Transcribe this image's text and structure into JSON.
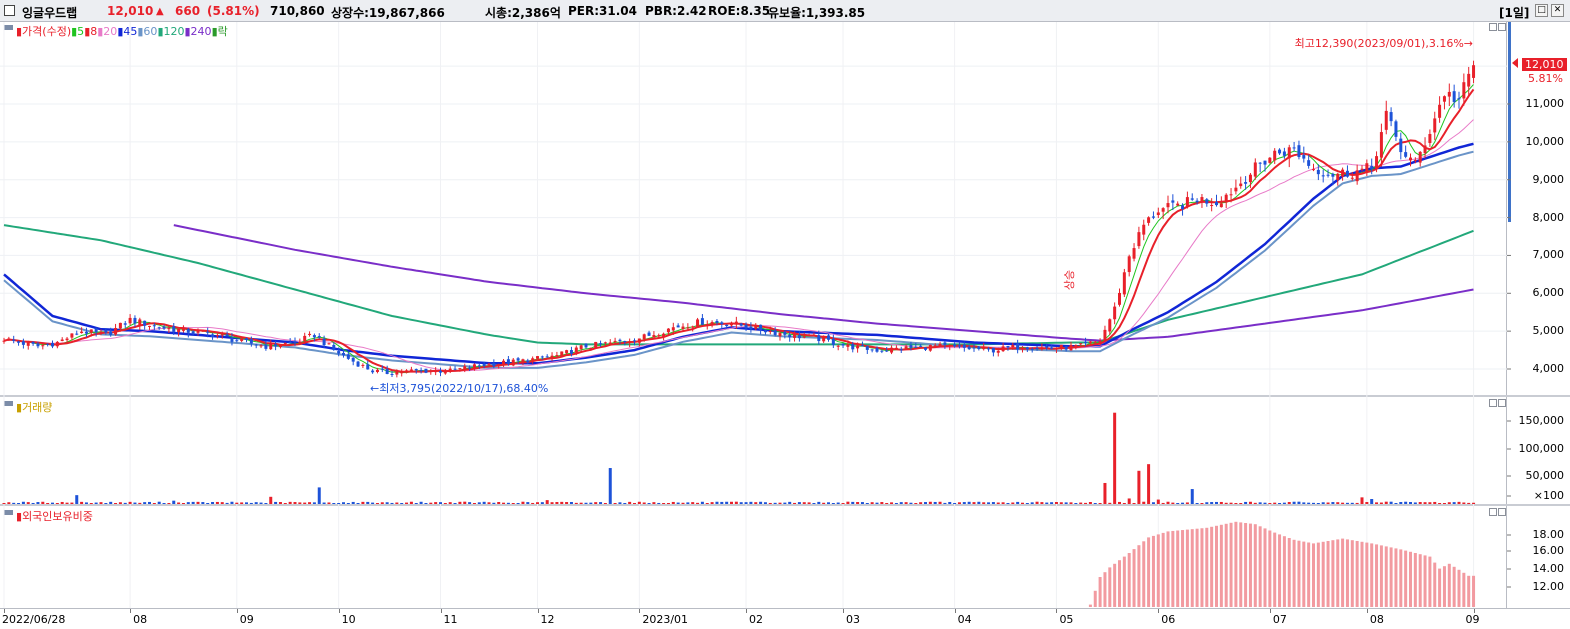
{
  "header": {
    "stock_name": "잉글우드랩",
    "price": "12,010",
    "change_arrow": "▲",
    "change": "660",
    "change_pct": "(5.81%)",
    "volume": "710,860",
    "listed_shares": "상장수:19,867,866",
    "market_cap": "시총:2,386억",
    "per": "PER:31.04",
    "pbr": "PBR:2.42",
    "roe": "ROE:8.35",
    "reserve_ratio": "유보율:1,393.85",
    "period": "[1일]",
    "minimize_label": "□",
    "close_label": "✕"
  },
  "colors": {
    "up": "#e8202a",
    "down": "#1d52d8",
    "ma5": "#1fc41f",
    "ma8": "#e8202a",
    "ma20": "#e87ac8",
    "ma45": "#1026d6",
    "ma60": "#6a94c8",
    "ma120": "#22a87a",
    "ma240": "#7a2ec8",
    "fall": "#2a9a2a",
    "volume_legend": "#c8a000",
    "foreign_bar": "#f29aa0"
  },
  "price_panel": {
    "legend": [
      {
        "label": "가격(수정)",
        "color": "#e8202a"
      },
      {
        "label": "5",
        "color": "#1fc41f"
      },
      {
        "label": "8",
        "color": "#e8202a"
      },
      {
        "label": "20",
        "color": "#e87ac8"
      },
      {
        "label": "45",
        "color": "#1026d6"
      },
      {
        "label": "60",
        "color": "#6a94c8"
      },
      {
        "label": "120",
        "color": "#22a87a"
      },
      {
        "label": "240",
        "color": "#7a2ec8"
      },
      {
        "label": "락",
        "color": "#2a9a2a"
      }
    ],
    "high_annotation": "최고12,390(2023/09/01),3.16%→",
    "low_annotation": "←최저3,795(2022/10/17),68.40%",
    "event_label": "상승",
    "current_price_tag": "12,010",
    "current_pct_tag": "5.81%",
    "y_ticks": [
      "11,000",
      "10,000",
      "9,000",
      "8,000",
      "7,000",
      "6,000",
      "5,000",
      "4,000"
    ]
  },
  "volume_panel": {
    "legend": "거래량",
    "y_ticks": [
      "150,000",
      "100,000",
      "50,000",
      "×100"
    ]
  },
  "foreign_panel": {
    "legend": "외국인보유비중",
    "y_ticks": [
      "18.00",
      "16.00",
      "14.00",
      "12.00"
    ]
  },
  "x_axis": {
    "labels": [
      "2022/06/28",
      "08",
      "09",
      "10",
      "11",
      "12",
      "2023/01",
      "02",
      "03",
      "04",
      "05",
      "06",
      "07",
      "08",
      "09"
    ]
  },
  "chart_data": [
    {
      "type": "line",
      "title": "",
      "y_range": [
        3500,
        12600
      ],
      "x_range": [
        "2022/06/28",
        "2023/09/01"
      ],
      "series": [
        {
          "name": "가격(수정)",
          "anchors": [
            [
              0,
              4700
            ],
            [
              10,
              4600
            ],
            [
              20,
              4700
            ],
            [
              28,
              5200
            ],
            [
              40,
              5000
            ],
            [
              50,
              4800
            ],
            [
              58,
              4600
            ],
            [
              66,
              4900
            ],
            [
              70,
              4500
            ],
            [
              78,
              3900
            ],
            [
              90,
              3950
            ],
            [
              104,
              4100
            ],
            [
              112,
              4300
            ],
            [
              120,
              4600
            ],
            [
              130,
              4750
            ],
            [
              140,
              5000
            ],
            [
              150,
              5200
            ],
            [
              160,
              5000
            ],
            [
              170,
              4800
            ],
            [
              180,
              4550
            ],
            [
              190,
              4500
            ],
            [
              200,
              4600
            ],
            [
              212,
              4500
            ],
            [
              222,
              4600
            ],
            [
              227,
              4800
            ],
            [
              232,
              7000
            ],
            [
              236,
              8000
            ],
            [
              242,
              8300
            ],
            [
              252,
              8400
            ],
            [
              260,
              9400
            ],
            [
              266,
              9800
            ],
            [
              270,
              9300
            ],
            [
              276,
              9200
            ],
            [
              282,
              9400
            ],
            [
              286,
              10500
            ],
            [
              290,
              9400
            ],
            [
              292,
              9300
            ],
            [
              296,
              10800
            ],
            [
              300,
              11200
            ],
            [
              303,
              12010
            ]
          ],
          "points": [
            [
              0,
              4800
            ],
            [
              3,
              4700
            ],
            [
              7,
              4600
            ],
            [
              11,
              4700
            ],
            [
              16,
              5000
            ],
            [
              21,
              4900
            ],
            [
              26,
              5300
            ],
            [
              32,
              5100
            ],
            [
              38,
              5000
            ],
            [
              44,
              4900
            ],
            [
              48,
              4750
            ],
            [
              54,
              4600
            ],
            [
              60,
              4700
            ],
            [
              64,
              4900
            ],
            [
              68,
              4500
            ],
            [
              72,
              4200
            ],
            [
              76,
              3950
            ],
            [
              79,
              3900
            ],
            [
              84,
              3950
            ],
            [
              92,
              3950
            ],
            [
              98,
              4100
            ],
            [
              106,
              4200
            ],
            [
              114,
              4350
            ],
            [
              120,
              4600
            ],
            [
              126,
              4700
            ],
            [
              132,
              4850
            ],
            [
              138,
              5100
            ],
            [
              144,
              5250
            ],
            [
              150,
              5200
            ],
            [
              156,
              5050
            ],
            [
              162,
              4900
            ],
            [
              168,
              4800
            ],
            [
              174,
              4600
            ],
            [
              180,
              4500
            ],
            [
              186,
              4550
            ],
            [
              192,
              4600
            ],
            [
              198,
              4550
            ],
            [
              204,
              4500
            ],
            [
              210,
              4600
            ],
            [
              216,
              4550
            ],
            [
              222,
              4600
            ],
            [
              226,
              4750
            ],
            [
              229,
              5600
            ],
            [
              232,
              7000
            ],
            [
              235,
              7800
            ],
            [
              238,
              8200
            ],
            [
              242,
              8300
            ],
            [
              246,
              8500
            ],
            [
              250,
              8400
            ],
            [
              254,
              8800
            ],
            [
              258,
              9300
            ],
            [
              262,
              9700
            ],
            [
              266,
              9800
            ],
            [
              270,
              9300
            ],
            [
              274,
              9150
            ],
            [
              278,
              9200
            ],
            [
              282,
              9300
            ],
            [
              285,
              10700
            ],
            [
              288,
              9800
            ],
            [
              291,
              9400
            ],
            [
              294,
              10300
            ],
            [
              297,
              11300
            ],
            [
              300,
              11100
            ],
            [
              303,
              12010
            ]
          ]
        },
        {
          "name": "45",
          "points": [
            [
              0,
              6500
            ],
            [
              10,
              5400
            ],
            [
              20,
              5050
            ],
            [
              30,
              5000
            ],
            [
              40,
              4900
            ],
            [
              50,
              4800
            ],
            [
              60,
              4700
            ],
            [
              70,
              4500
            ],
            [
              80,
              4350
            ],
            [
              90,
              4250
            ],
            [
              100,
              4150
            ],
            [
              110,
              4150
            ],
            [
              120,
              4300
            ],
            [
              130,
              4500
            ],
            [
              140,
              4850
            ],
            [
              150,
              5100
            ],
            [
              160,
              5000
            ],
            [
              170,
              4950
            ],
            [
              180,
              4900
            ],
            [
              190,
              4800
            ],
            [
              200,
              4700
            ],
            [
              210,
              4650
            ],
            [
              220,
              4600
            ],
            [
              226,
              4600
            ],
            [
              232,
              5000
            ],
            [
              240,
              5500
            ],
            [
              250,
              6300
            ],
            [
              260,
              7300
            ],
            [
              270,
              8500
            ],
            [
              276,
              9100
            ],
            [
              282,
              9300
            ],
            [
              288,
              9350
            ],
            [
              294,
              9600
            ],
            [
              300,
              9850
            ],
            [
              303,
              9950
            ]
          ]
        },
        {
          "name": "120",
          "points": [
            [
              0,
              7800
            ],
            [
              20,
              7400
            ],
            [
              40,
              6800
            ],
            [
              60,
              6100
            ],
            [
              80,
              5400
            ],
            [
              100,
              4900
            ],
            [
              110,
              4700
            ],
            [
              120,
              4650
            ],
            [
              140,
              4650
            ],
            [
              160,
              4650
            ],
            [
              180,
              4650
            ],
            [
              200,
              4650
            ],
            [
              220,
              4700
            ],
            [
              226,
              4700
            ],
            [
              240,
              5300
            ],
            [
              260,
              5900
            ],
            [
              280,
              6500
            ],
            [
              303,
              7650
            ]
          ]
        },
        {
          "name": "240",
          "points": [
            [
              35,
              7800
            ],
            [
              60,
              7150
            ],
            [
              80,
              6700
            ],
            [
              100,
              6300
            ],
            [
              120,
              6000
            ],
            [
              140,
              5750
            ],
            [
              160,
              5450
            ],
            [
              180,
              5200
            ],
            [
              200,
              5000
            ],
            [
              220,
              4800
            ],
            [
              226,
              4750
            ],
            [
              240,
              4850
            ],
            [
              260,
              5200
            ],
            [
              280,
              5550
            ],
            [
              303,
              6100
            ]
          ]
        }
      ]
    },
    {
      "type": "bar",
      "title": "거래량",
      "y_range": [
        0,
        170000
      ],
      "spikes": [
        [
          15,
          16000
        ],
        [
          35,
          6000
        ],
        [
          55,
          13000
        ],
        [
          65,
          30000
        ],
        [
          112,
          7000
        ],
        [
          125,
          65000
        ],
        [
          227,
          38000
        ],
        [
          229,
          165000
        ],
        [
          232,
          10000
        ],
        [
          234,
          60000
        ],
        [
          236,
          72000
        ],
        [
          238,
          8000
        ],
        [
          245,
          27000
        ],
        [
          280,
          12000
        ],
        [
          282,
          9000
        ]
      ],
      "base": 3000
    },
    {
      "type": "bar",
      "title": "외국인보유비중",
      "y_range": [
        10.8,
        19.5
      ],
      "points": [
        [
          0,
          11.4
        ],
        [
          10,
          11.2
        ],
        [
          20,
          11.15
        ],
        [
          40,
          11.0
        ],
        [
          60,
          11.05
        ],
        [
          80,
          11.0
        ],
        [
          100,
          11.0
        ],
        [
          120,
          11.15
        ],
        [
          140,
          11.2
        ],
        [
          160,
          11.3
        ],
        [
          180,
          11.2
        ],
        [
          200,
          11.3
        ],
        [
          215,
          11.3
        ],
        [
          216,
          11.2
        ],
        [
          218,
          11.1
        ],
        [
          222,
          11.4
        ],
        [
          224,
          12.2
        ],
        [
          226,
          14.5
        ],
        [
          228,
          15.3
        ],
        [
          232,
          16.5
        ],
        [
          236,
          17.8
        ],
        [
          240,
          18.3
        ],
        [
          248,
          18.6
        ],
        [
          254,
          19.1
        ],
        [
          258,
          18.9
        ],
        [
          262,
          18.2
        ],
        [
          266,
          17.6
        ],
        [
          270,
          17.3
        ],
        [
          276,
          17.7
        ],
        [
          282,
          17.3
        ],
        [
          288,
          16.8
        ],
        [
          292,
          16.4
        ],
        [
          294,
          16.2
        ],
        [
          296,
          15.2
        ],
        [
          298,
          15.6
        ],
        [
          302,
          14.6
        ],
        [
          303,
          14.6
        ]
      ]
    }
  ]
}
